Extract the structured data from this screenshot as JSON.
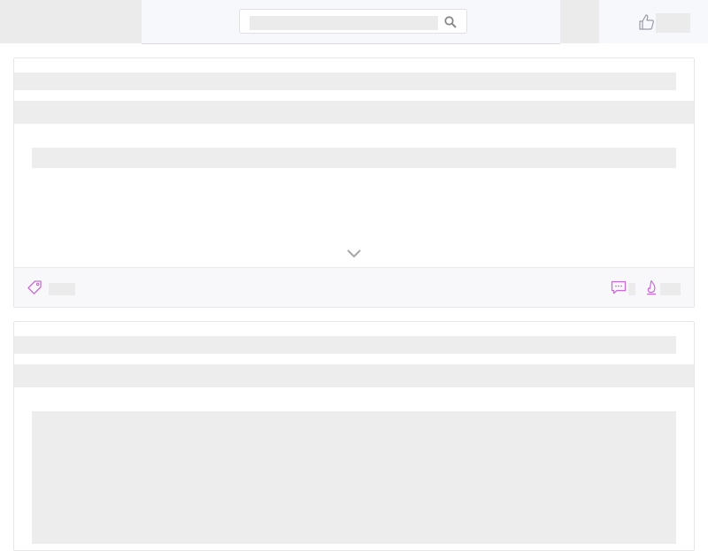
{
  "page": {
    "state": "loading",
    "colors": {
      "placeholder": "#ededed",
      "accent": "#c86dd7",
      "header_bg": "#ebebeb",
      "footer_bg": "#f8f8fb"
    }
  },
  "header": {
    "search": {
      "placeholder": "",
      "icon": "search-icon"
    },
    "actions": {
      "icon": "thumbs-up-icon"
    }
  },
  "cards": [
    {
      "expand_icon": "chevron-down-icon",
      "footer": {
        "tag_icon": "tag-icon",
        "comment_icon": "comment-icon",
        "flame_icon": "flame-icon"
      }
    },
    {}
  ]
}
